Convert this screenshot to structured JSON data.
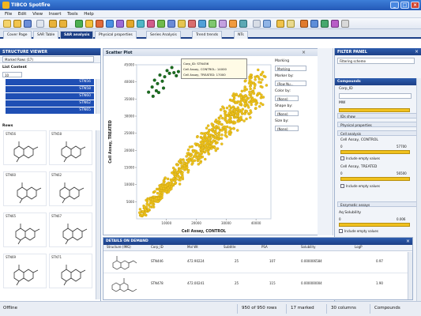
{
  "window": {
    "title": "TIBCO Spotfire"
  },
  "menu": [
    "File",
    "Edit",
    "View",
    "Insert",
    "Tools",
    "Help"
  ],
  "tabs": [
    "Cover Page",
    "SAR Table",
    "SAR analysis",
    "Physical properties",
    "Series Analysis",
    "Trend trends",
    "NTs"
  ],
  "active_tab": 2,
  "structure_viewer": {
    "title": "STRUCTURE VIEWER",
    "dropdown": "Marked Rows (17)",
    "list_header": "List Content",
    "list_number": "10",
    "list_items": [
      "STN56",
      "STN58",
      "STN60",
      "STN62",
      "STN65"
    ],
    "rows_label": "Rows",
    "molecules": [
      "STN56",
      "STN58",
      "STN60",
      "STN62",
      "STN65",
      "STN67",
      "STN69",
      "STN71"
    ]
  },
  "scatter": {
    "title": "Scatter Plot",
    "tooltip": [
      "Corp_ID: STN456",
      "Cell Assay, CONTROL: 14000",
      "Cell Assay, TREATED: 17000"
    ],
    "marking_label": "Marking",
    "marking_value": "Marking",
    "marker_label": "Marker by:",
    "marker_value": "(Row Nu...",
    "color_label": "Color by:",
    "color_value": "(None)",
    "shape_label": "Shape by:",
    "shape_value": "(None)",
    "size_label": "Size by:",
    "size_value": "(None)",
    "xlabel": "Cell Assay, CONTROL",
    "ylabel": "Cell Assay, TREATED"
  },
  "chart_data": {
    "type": "scatter",
    "xlim": [
      0,
      45000
    ],
    "ylim": [
      0,
      45000
    ],
    "x_ticks": [
      "10000",
      "20000",
      "30000",
      "40000"
    ],
    "y_ticks": [
      "5000",
      "10000",
      "15000",
      "20000",
      "25000",
      "30000",
      "35000",
      "40000",
      "45000"
    ],
    "marked_color": "#1a6e1f",
    "unmarked_color": "#eec21b",
    "marked_points": [
      [
        4000,
        37000
      ],
      [
        5200,
        38500
      ],
      [
        6000,
        40500
      ],
      [
        7000,
        39500
      ],
      [
        7800,
        42000
      ],
      [
        8600,
        40200
      ],
      [
        9400,
        41500
      ],
      [
        10200,
        43300
      ],
      [
        11000,
        42500
      ],
      [
        11800,
        44200
      ],
      [
        12500,
        42700
      ],
      [
        13300,
        41800
      ],
      [
        14000,
        43000
      ],
      [
        6600,
        37400
      ],
      [
        9000,
        38200
      ],
      [
        5500,
        35800
      ],
      [
        7400,
        36900
      ]
    ],
    "n_points": 700
  },
  "filter": {
    "title": "FILTER PANEL",
    "search": "Filtering scheme",
    "compounds": "Compounds",
    "corp_id": "Corp_ID",
    "mw": "MW",
    "sections": [
      "IDs show",
      "Physical properties",
      "Cell analysis"
    ],
    "control_label": "Cell Assay, CONTROL",
    "control_range": [
      "0",
      "57700"
    ],
    "include_empty": "Include empty values",
    "treated_label": "Cell Assay, TREATED",
    "treated_range": [
      "0",
      "56500"
    ],
    "enzyme_section": "Enzymatic assays",
    "solubility_label": "Aq Solubility",
    "solubility_range": [
      "0",
      "0.006"
    ]
  },
  "details": {
    "title": "DETAILS ON DEMAND",
    "columns": [
      "Structure (IMG)",
      "Corp_ID",
      "Mol Wt",
      "Subtitle",
      "PSA",
      "Solubility",
      "LogP"
    ],
    "rows": [
      [
        "",
        "STN446",
        "472.90224",
        "25",
        "107",
        "0.000006584",
        "0.97"
      ],
      [
        "",
        "STN478",
        "472.00241",
        "25",
        "115",
        "0.000000004",
        "1.90"
      ]
    ]
  },
  "status": {
    "left": "Offline",
    "rows": "950 of 950 rows",
    "marked": "17 marked",
    "columns": "30 columns",
    "table": "Compounds"
  }
}
